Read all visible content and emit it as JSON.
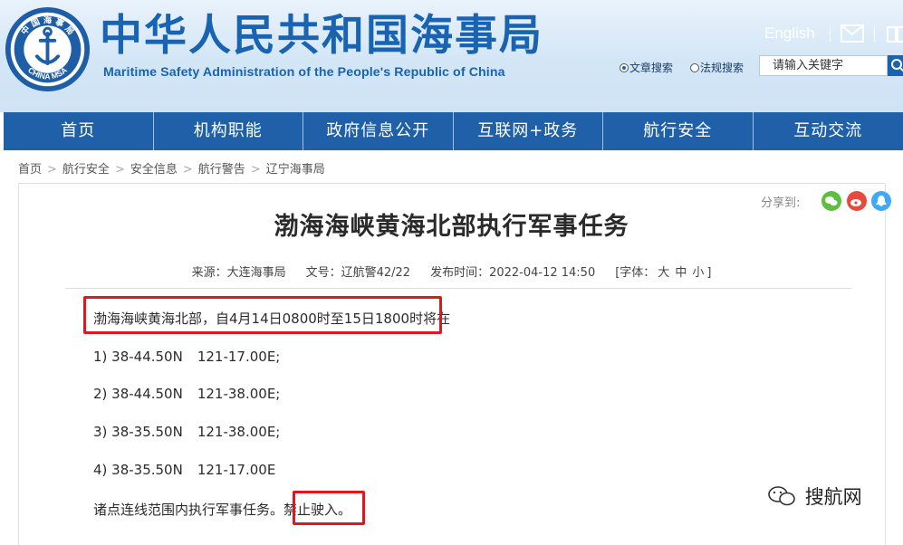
{
  "header": {
    "logo_top_text": "中 国 海 事 局",
    "logo_bottom_text": "CHINA MSA",
    "title_cn": "中华人民共和国海事局",
    "title_en": "Maritime Safety Administration of the People's Republic of China",
    "lang_link": "English",
    "mail_icon": "mail-icon",
    "book_icon": "book-icon",
    "search_options": [
      {
        "label": "文章搜索",
        "selected": true
      },
      {
        "label": "法规搜索",
        "selected": false
      }
    ],
    "search_placeholder": "请输入关键字",
    "brand_color": "#1864b2"
  },
  "nav": {
    "items": [
      "首页",
      "机构职能",
      "政府信息公开",
      "互联网+政务",
      "航行安全",
      "互动交流"
    ],
    "bg_color": "#1f60a8"
  },
  "breadcrumb": [
    "首页",
    "航行安全",
    "安全信息",
    "航行警告",
    "辽宁海事局"
  ],
  "share": {
    "label": "分享到:",
    "icons": [
      "wechat-icon",
      "weibo-icon",
      "qq-icon"
    ]
  },
  "article": {
    "title": "渤海海峡黄海北部执行军事任务",
    "meta": {
      "source": "来源：大连海事局",
      "doc_no": "文号：辽航警42/22",
      "publish_time": "发布时间：2022-04-12 14:50",
      "font_label": "[字体：",
      "font_sizes": [
        "大",
        "中",
        "小"
      ],
      "font_close": "]"
    },
    "intro": "渤海海峡黄海北部，自4月14日0800时至15日1800时将在",
    "coords": [
      {
        "label": "1) 38-44.50N",
        "lon": "121-17.00E;"
      },
      {
        "label": "2) 38-44.50N",
        "lon": "121-38.00E;"
      },
      {
        "label": "3) 38-35.50N",
        "lon": "121-38.00E;"
      },
      {
        "label": "4) 38-35.50N",
        "lon": "121-17.00E"
      }
    ],
    "closing_main": "诸点连线范围内执行军事任务。",
    "closing_highlight": "禁止驶入。",
    "highlight_color": "#e0171d"
  },
  "watermark": "搜航网"
}
